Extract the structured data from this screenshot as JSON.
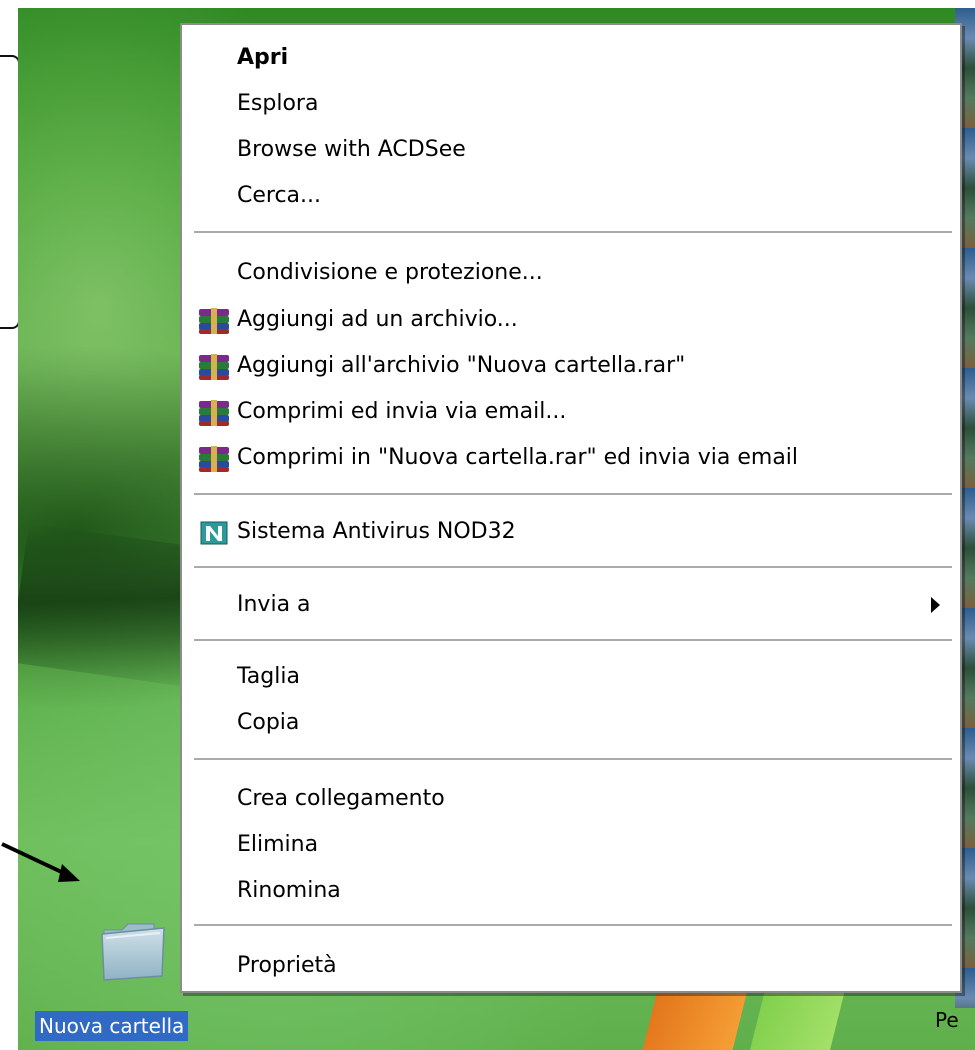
{
  "desktop": {
    "folder_label": "Nuova cartella",
    "right_edge_text": "Pe"
  },
  "context_menu": {
    "items": [
      {
        "label": "Apri",
        "bold": true
      },
      {
        "label": "Esplora"
      },
      {
        "label": "Browse with ACDSee"
      },
      {
        "label": "Cerca..."
      },
      {
        "label": "Condivisione e protezione..."
      },
      {
        "label": "Aggiungi ad un archivio...",
        "icon": "winrar-icon"
      },
      {
        "label": "Aggiungi all'archivio \"Nuova cartella.rar\"",
        "icon": "winrar-icon"
      },
      {
        "label": "Comprimi ed invia via email...",
        "icon": "winrar-icon"
      },
      {
        "label": "Comprimi in \"Nuova cartella.rar\" ed invia via email",
        "icon": "winrar-icon"
      },
      {
        "label": "Sistema Antivirus NOD32",
        "icon": "nod32-icon"
      },
      {
        "label": "Invia a",
        "submenu": true
      },
      {
        "label": "Taglia"
      },
      {
        "label": "Copia"
      },
      {
        "label": "Crea collegamento"
      },
      {
        "label": "Elimina"
      },
      {
        "label": "Rinomina"
      },
      {
        "label": "Proprietà"
      }
    ]
  },
  "colors": {
    "selection_blue": "#316ac5",
    "menu_background": "#ffffff",
    "separator": "#aaaaaa"
  }
}
